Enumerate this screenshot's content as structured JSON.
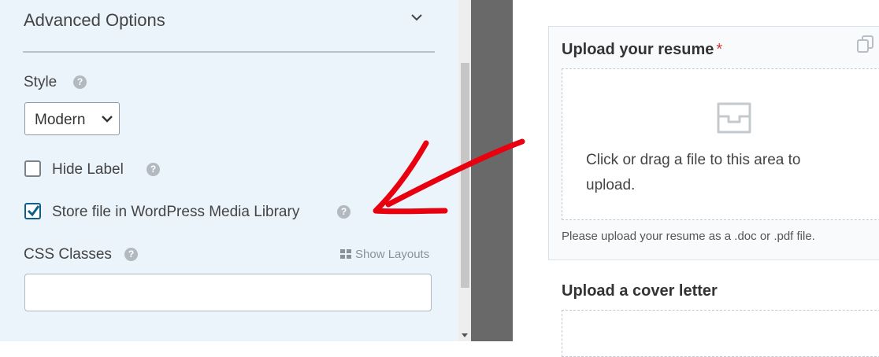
{
  "left_panel": {
    "section_title": "Advanced Options",
    "style_label": "Style",
    "style_select_value": "Modern",
    "hide_label": "Hide Label",
    "hide_label_checked": false,
    "store_file_label": "Store file in WordPress Media Library",
    "store_file_checked": true,
    "css_classes_label": "CSS Classes",
    "show_layouts_label": "Show Layouts",
    "css_classes_value": ""
  },
  "preview": {
    "field1_title": "Upload your resume",
    "field1_required_mark": "*",
    "dropzone_text": "Click or drag a file to this area to upload.",
    "field1_description": "Please upload your resume as a .doc or .pdf file.",
    "field2_title": "Upload a cover letter"
  },
  "colors": {
    "panel_bg": "#ebf3fb",
    "checkbox_checked": "#0e5f8a",
    "annotation_arrow": "#e8000f",
    "required": "#d63638"
  },
  "icons": [
    "chevron-down-icon",
    "help-icon",
    "checkmark-icon",
    "grid-icon",
    "duplicate-icon",
    "inbox-icon",
    "annotation-arrow"
  ]
}
